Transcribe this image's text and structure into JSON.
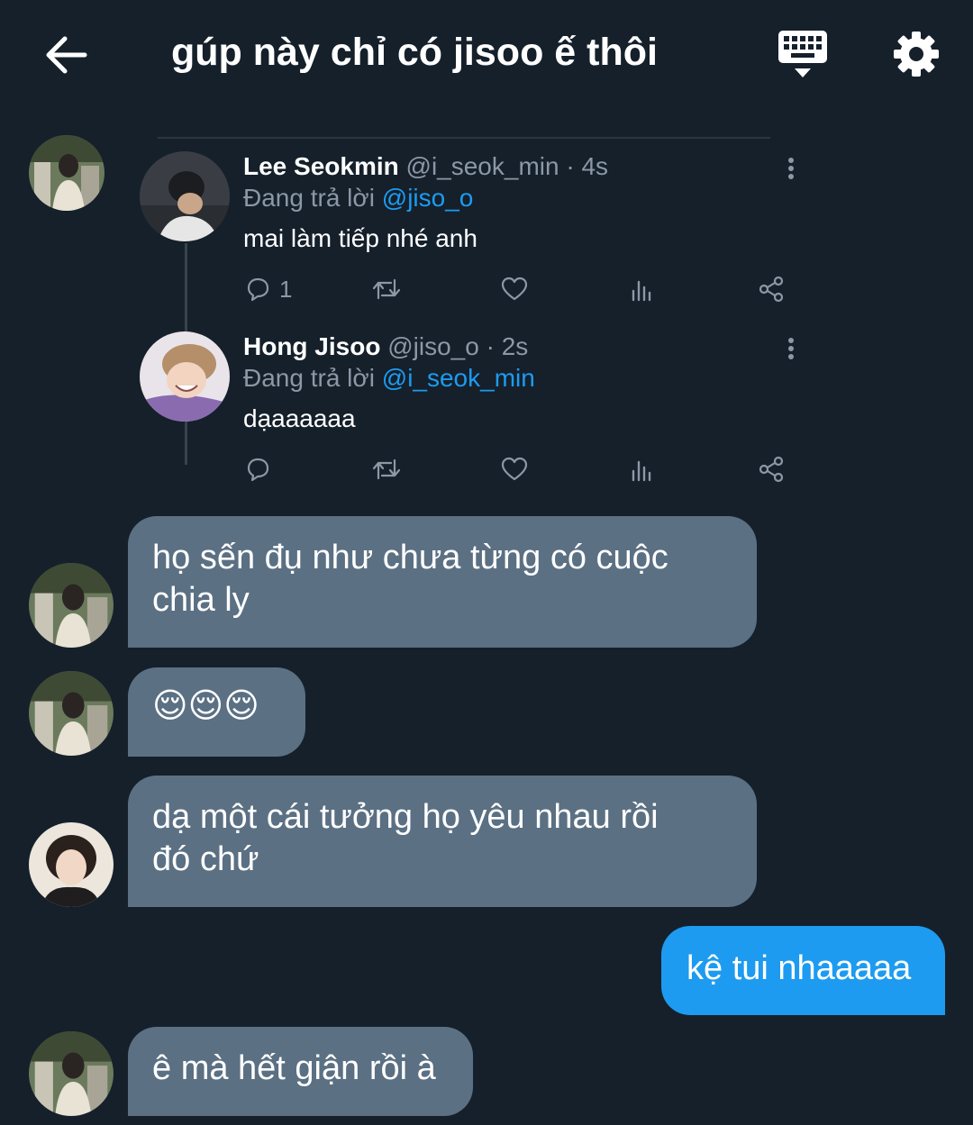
{
  "header": {
    "title": "gúp này chỉ có jisoo ế thôi",
    "back_icon": "arrow-left-icon",
    "keyboard_icon": "keyboard-icon",
    "settings_icon": "gear-icon"
  },
  "tweet": {
    "first": {
      "name": "Lee Seokmin",
      "handle": "@i_seok_min · 4s",
      "reply_prefix": "Đang trả lời ",
      "reply_to": "@jiso_o",
      "text": "mai làm tiếp nhé anh",
      "reply_count": "1"
    },
    "second": {
      "name": "Hong Jisoo",
      "handle": "@jiso_o · 2s",
      "reply_prefix": "Đang trả lời ",
      "reply_to": "@i_seok_min",
      "text": "dạaaaaaa",
      "reply_count": ""
    }
  },
  "messages": [
    {
      "sender": "other",
      "text_lines": [
        "họ sến đụ như chưa từng có cuộc",
        "chia ly"
      ]
    },
    {
      "sender": "other",
      "text_lines": [
        "😌😌😌"
      ]
    },
    {
      "sender": "other",
      "text_lines": [
        "dạ một cái tưởng họ yêu nhau rồi",
        "đó chứ"
      ]
    },
    {
      "sender": "me",
      "text_lines": [
        "kệ tui nhaaaaa"
      ]
    },
    {
      "sender": "other",
      "text_lines": [
        "ê mà hết giận rồi à"
      ]
    }
  ],
  "colors": {
    "background": "#15202b",
    "bubble_other": "#5b7083",
    "bubble_me": "#1d9bf0",
    "link": "#1d9bf0",
    "muted": "#8b98a5"
  }
}
